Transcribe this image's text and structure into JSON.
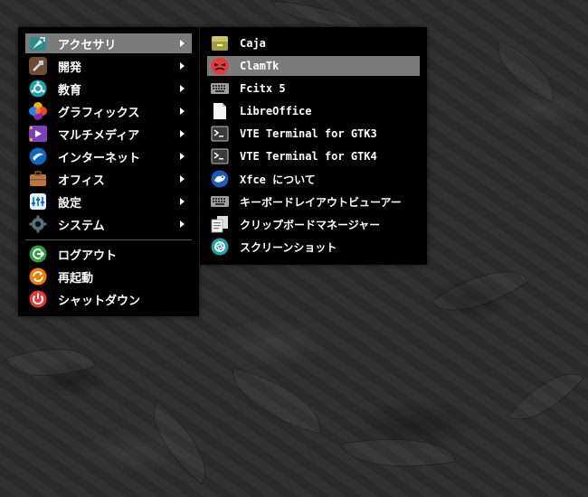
{
  "main_menu": {
    "items": [
      {
        "label": "アクセサリ",
        "icon": "accessories-icon"
      },
      {
        "label": "開発",
        "icon": "development-icon"
      },
      {
        "label": "教育",
        "icon": "education-icon"
      },
      {
        "label": "グラフィックス",
        "icon": "graphics-icon"
      },
      {
        "label": "マルチメディア",
        "icon": "multimedia-icon"
      },
      {
        "label": "インターネット",
        "icon": "internet-icon"
      },
      {
        "label": "オフィス",
        "icon": "office-icon"
      },
      {
        "label": "設定",
        "icon": "settings-icon"
      },
      {
        "label": "システム",
        "icon": "system-icon"
      }
    ],
    "actions": [
      {
        "label": "ログアウト",
        "icon": "logout-icon"
      },
      {
        "label": "再起動",
        "icon": "restart-icon"
      },
      {
        "label": "シャットダウン",
        "icon": "shutdown-icon"
      }
    ],
    "selected": "アクセサリ"
  },
  "submenu": {
    "items": [
      {
        "label": "Caja",
        "icon": "file-manager-icon"
      },
      {
        "label": "ClamTk",
        "icon": "antivirus-icon"
      },
      {
        "label": "Fcitx 5",
        "icon": "keyboard-icon"
      },
      {
        "label": "LibreOffice",
        "icon": "document-icon"
      },
      {
        "label": "VTE Terminal for GTK3",
        "icon": "terminal-icon"
      },
      {
        "label": "VTE Terminal for GTK4",
        "icon": "terminal-icon"
      },
      {
        "label": "Xfce について",
        "icon": "xfce-icon"
      },
      {
        "label": "キーボードレイアウトビューアー",
        "icon": "keyboard-icon"
      },
      {
        "label": "クリップボードマネージャー",
        "icon": "clipboard-icon"
      },
      {
        "label": "スクリーンショット",
        "icon": "camera-icon"
      }
    ],
    "highlighted": "ClamTk"
  },
  "colors": {
    "menu_bg": "#000000",
    "selection": "#7b7b7b",
    "text": "#ffffff"
  }
}
